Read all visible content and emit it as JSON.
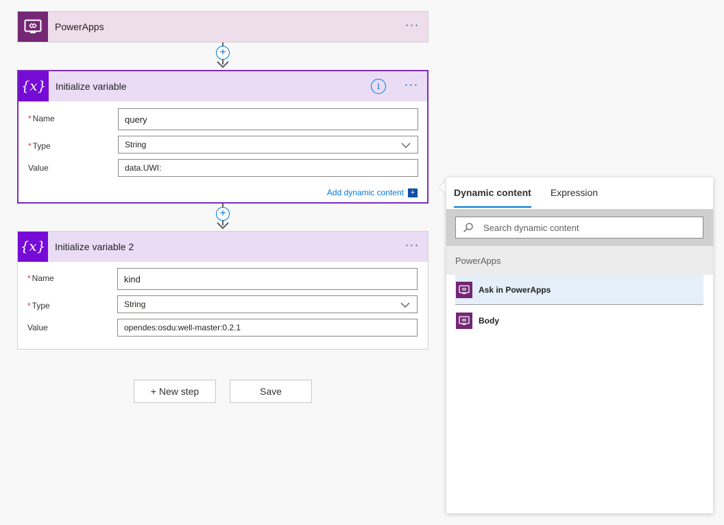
{
  "steps": {
    "trigger": {
      "title": "PowerApps",
      "more": "···"
    },
    "init1": {
      "title": "Initialize variable",
      "info": "i",
      "more": "···",
      "name_label": "Name",
      "name_value": "query",
      "type_label": "Type",
      "type_value": "String",
      "value_label": "Value",
      "value_value": "data.UWI:",
      "add_dynamic": "Add dynamic content",
      "add_dynamic_plus": "+"
    },
    "init2": {
      "title": "Initialize variable 2",
      "more": "···",
      "name_label": "Name",
      "name_value": "kind",
      "type_label": "Type",
      "type_value": "String",
      "value_label": "Value",
      "value_value": "opendes:osdu:well-master:0.2.1"
    },
    "required_mark": "*"
  },
  "buttons": {
    "new_step": "+ New step",
    "save": "Save"
  },
  "connector_plus": "+",
  "dynamic_panel": {
    "tabs": [
      {
        "label": "Dynamic content",
        "active": true
      },
      {
        "label": "Expression",
        "active": false
      }
    ],
    "search_placeholder": "Search dynamic content",
    "section": "PowerApps",
    "items": [
      {
        "label": "Ask in PowerApps"
      },
      {
        "label": "Body"
      }
    ]
  },
  "colors": {
    "powerapps": "#742774",
    "variable": "#770bd6",
    "accent": "#0078d4",
    "selected_border": "#7c2bbf"
  },
  "icons": {
    "trigger": "powerapps-icon",
    "variable": "variable-icon",
    "search": "search-icon",
    "chevron": "chevron-down-icon"
  }
}
